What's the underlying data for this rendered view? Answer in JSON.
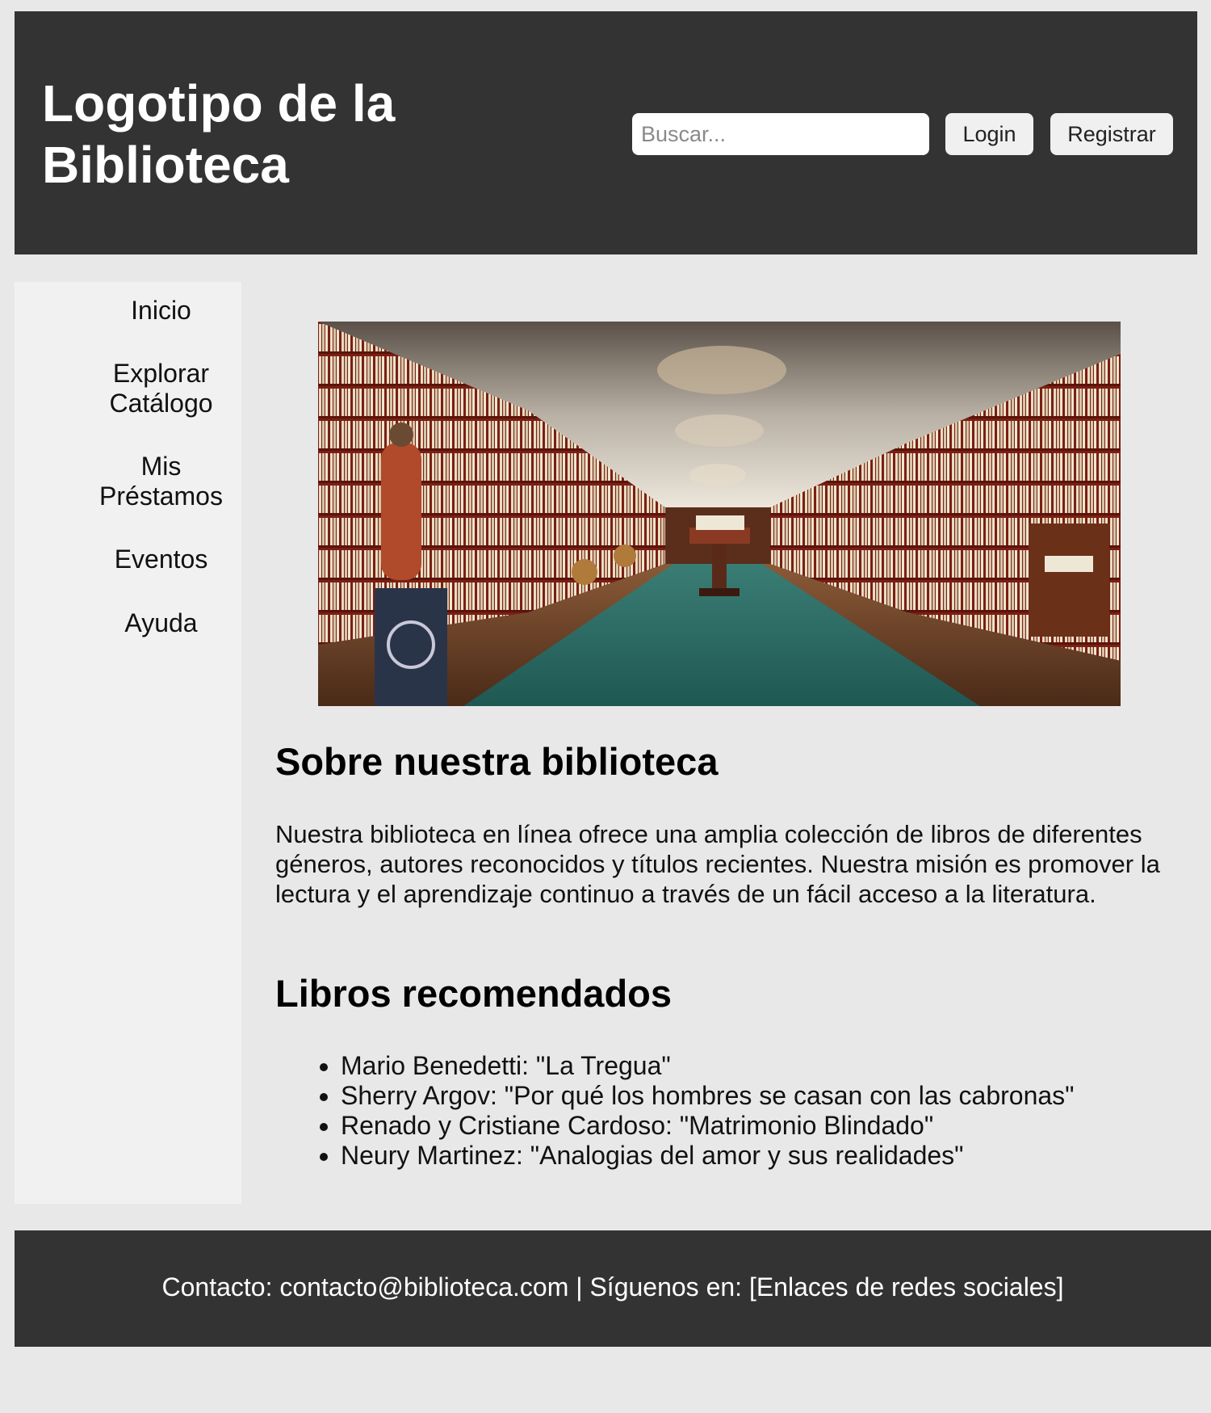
{
  "header": {
    "logo": "Logotipo de la Biblioteca",
    "search_placeholder": "Buscar...",
    "login_label": "Login",
    "register_label": "Registrar"
  },
  "sidebar": {
    "items": [
      {
        "label": "Inicio"
      },
      {
        "label": "Explorar Catálogo"
      },
      {
        "label": "Mis Préstamos"
      },
      {
        "label": "Eventos"
      },
      {
        "label": "Ayuda"
      }
    ]
  },
  "main": {
    "about_title": "Sobre nuestra biblioteca",
    "about_text": "Nuestra biblioteca en línea ofrece una amplia colección de libros de diferentes géneros, autores reconocidos y títulos recientes. Nuestra misión es promover la lectura y el aprendizaje continuo a través de un fácil acceso a la literatura.",
    "books_title": "Libros recomendados",
    "books": [
      "Mario Benedetti: \"La Tregua\"",
      "Sherry Argov: \"Por qué los hombres se casan con las cabronas\"",
      "Renado y Cristiane Cardoso: \"Matrimonio Blindado\"",
      "Neury Martinez: \"Analogias del amor y sus realidades\""
    ]
  },
  "footer": {
    "text": "Contacto: contacto@biblioteca.com | Síguenos en: [Enlaces de redes sociales]"
  },
  "colors": {
    "header_bg": "#333333",
    "page_bg": "#e8e8e8",
    "sidebar_bg": "#f1f1f1",
    "footer_bg": "#333333"
  }
}
